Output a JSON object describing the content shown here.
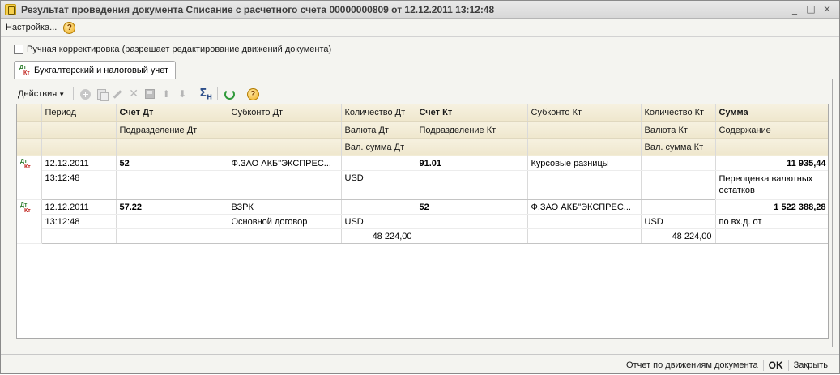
{
  "window": {
    "title": "Результат проведения документа Списание с расчетного счета 00000000809 от 12.12.2011 13:12:48",
    "controls": [
      "_",
      "□",
      "×"
    ]
  },
  "menubar": {
    "settings_label": "Настройка...",
    "help_glyph": "?"
  },
  "manual_correction": {
    "checked": false,
    "label": "Ручная корректировка (разрешает редактирование движений документа)"
  },
  "tab": {
    "icon_top": "Дт",
    "icon_bottom": "Кт",
    "label": "Бухгалтерский и налоговый учет"
  },
  "toolbar": {
    "actions_label": "Действия",
    "icons": [
      "add-icon",
      "copy-icon",
      "edit-icon",
      "delete-icon",
      "save-icon",
      "move-up-icon",
      "move-down-icon",
      "sum-icon",
      "refresh-icon",
      "help-icon"
    ],
    "sum_glyph": "Σ",
    "sum_sub": "H",
    "help_glyph": "?"
  },
  "table": {
    "header": {
      "row1": [
        "Период",
        "Счет Дт",
        "Субконто Дт",
        "Количество Дт",
        "Счет Кт",
        "Субконто Кт",
        "Количество Кт",
        "Сумма"
      ],
      "row2": [
        "Подразделение Дт",
        "",
        "Валюта Дт",
        "Подразделение Кт",
        "",
        "Валюта Кт",
        "Содержание"
      ],
      "row3": [
        "",
        "",
        "Вал. сумма Дт",
        "",
        "",
        "Вал. сумма Кт",
        ""
      ]
    },
    "records": [
      {
        "date": "12.12.2011",
        "time": "13:12:48",
        "account_dt": "52",
        "subconto_dt": [
          "Ф.ЗАО АКБ\"ЭКСПРЕС...",
          "",
          ""
        ],
        "qty_dt": "",
        "currency_dt": "USD",
        "cur_sum_dt": "",
        "account_kt": "91.01",
        "subconto_kt": [
          "Курсовые разницы",
          "",
          ""
        ],
        "qty_kt": "",
        "currency_kt": "",
        "cur_sum_kt": "",
        "amount": "11 935,44",
        "content": "Переоценка валютных остатков"
      },
      {
        "date": "12.12.2011",
        "time": "13:12:48",
        "account_dt": "57.22",
        "subconto_dt": [
          "ВЗРК",
          "Основной договор",
          ""
        ],
        "qty_dt": "",
        "currency_dt": "USD",
        "cur_sum_dt": "48 224,00",
        "account_kt": "52",
        "subconto_kt": [
          "Ф.ЗАО АКБ\"ЭКСПРЕС...",
          "",
          ""
        ],
        "qty_kt": "",
        "currency_kt": "USD",
        "cur_sum_kt": "48 224,00",
        "amount": "1 522 388,28",
        "content": " по вх.д. от"
      }
    ]
  },
  "statusbar": {
    "report_label": "Отчет по движениям документа",
    "ok_label": "OK",
    "close_label": "Закрыть"
  }
}
